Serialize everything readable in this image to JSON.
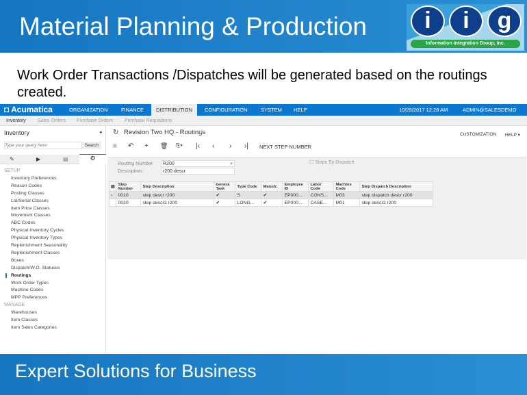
{
  "slide": {
    "title": "Material Planning & Production",
    "body": "Work Order Transactions /Dispatches will be generated based on the routings created.",
    "footer": "Expert Solutions for Business",
    "logo": {
      "letters": [
        "i",
        "i",
        "g"
      ],
      "tagline": "Information Integration Group, Inc."
    }
  },
  "app": {
    "brand": "Acumatica",
    "nav": [
      "ORGANIZATION",
      "FINANCE",
      "DISTRIBUTION",
      "CONFIGURATION",
      "SYSTEM",
      "HELP"
    ],
    "active_nav": "DISTRIBUTION",
    "datetime": "10/25/2017  12:28 AM",
    "user": "ADMIN@SALESDEMO",
    "subnav": [
      "Inventory",
      "Sales Orders",
      "Purchase Orders",
      "Purchase Requisitions"
    ],
    "left": {
      "title": "Inventory",
      "search_placeholder": "Type your query here",
      "search_button": "Search",
      "setup_label": "SETUP",
      "setup_items": [
        "Inventory Preferences",
        "Reason Codes",
        "Posting Classes",
        "Lot/Serial Classes",
        "Item Price Classes",
        "Movement Classes",
        "ABC Codes",
        "Physical Inventory Cycles",
        "Physical Inventory Types",
        "Replenishment Seasonality",
        "Replenishment Classes",
        "Boxes",
        "Dispatch/W.O. Statuses",
        "Routings",
        "Work Order Types",
        "Machine Codes",
        "MPP Preferences"
      ],
      "selected": "Routings",
      "manage_label": "MANAGE",
      "manage_items": [
        "Warehouses",
        "Item Classes",
        "Item Sales Categories"
      ]
    },
    "page": {
      "title": "Revision Two HQ - Routings",
      "customization": "CUSTOMIZATION",
      "help": "HELP",
      "next_step": "NEXT STEP NUMBER",
      "routing_label": "Routing Number:",
      "routing_value": "R200",
      "desc_label": "Description:",
      "desc_value": "r200 descr",
      "steps_by_dispatch": "Steps By Dispatch",
      "grid": {
        "columns": [
          "Step Number",
          "Step Description",
          "Genera Task",
          "Type Code",
          "Manufc",
          "Employee ID",
          "Labor Code",
          "Machine Code",
          "Step Dispatch Description"
        ],
        "rows": [
          [
            "0010",
            "step descr r200",
            "✔",
            "S",
            "✔",
            "EP000...",
            "CONS...",
            "M03",
            "step dispatch descr r200"
          ],
          [
            "0020",
            "step descr2 r200",
            "✔",
            "LONG...",
            "✔",
            "EP000...",
            "CASE...",
            "M01",
            "step descr2 r200"
          ]
        ]
      }
    }
  }
}
